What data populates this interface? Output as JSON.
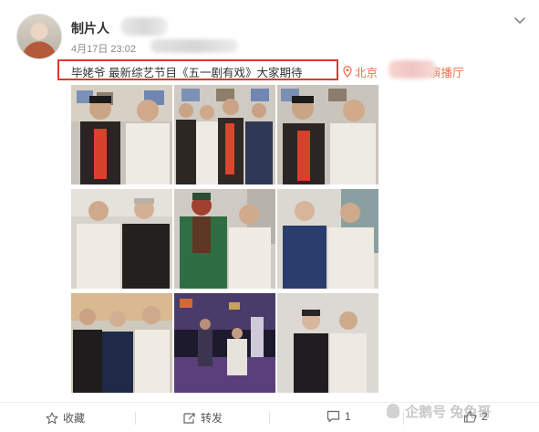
{
  "post": {
    "author": "制片人",
    "timestamp": "4月17日 23:02",
    "meta_suffix": "来自",
    "text": "毕姥爷 最新综艺节目《五一剧有戏》大家期待",
    "location_prefix": "北京",
    "location_suffix": "演播厅"
  },
  "actions": {
    "favorite": "收藏",
    "repost": "转发",
    "comment_count": "1",
    "like_count": "2"
  },
  "watermark": "企鹅号 兔兔哥",
  "colors": {
    "highlight_box": "#d83a34",
    "location": "#eb7350",
    "text": "#333333",
    "meta": "#888888"
  },
  "icons": [
    "chevron-down-icon",
    "location-pin-icon",
    "star-icon",
    "repost-icon",
    "comment-icon",
    "like-icon",
    "penguin-icon"
  ]
}
